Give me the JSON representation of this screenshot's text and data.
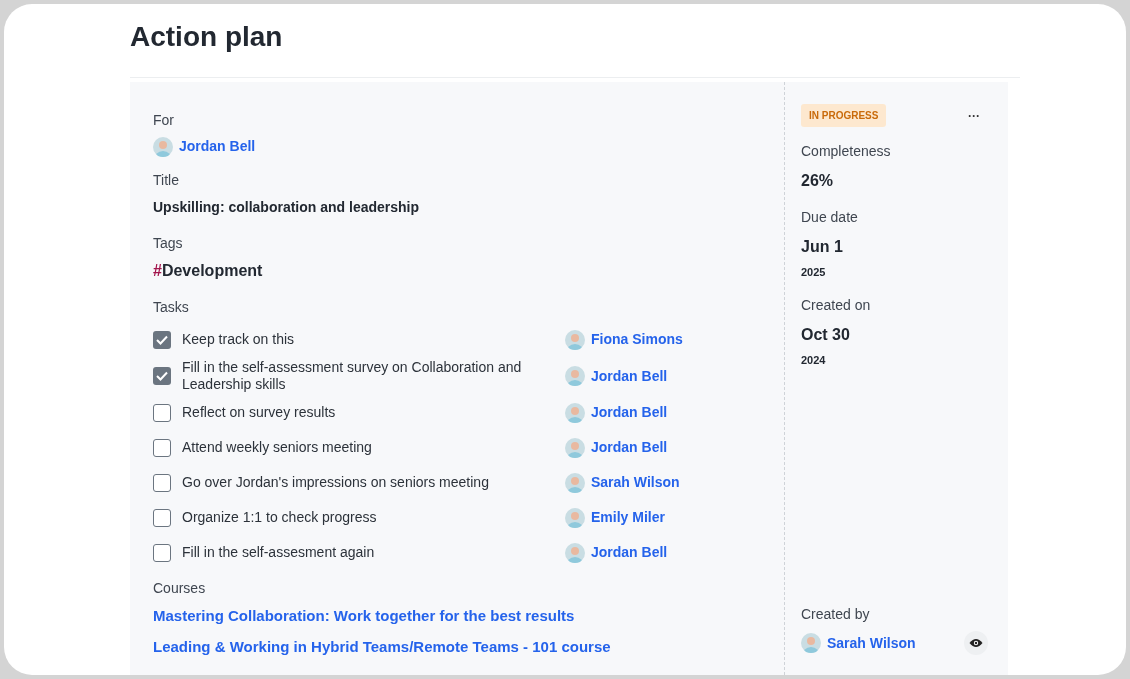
{
  "page": {
    "title": "Action plan"
  },
  "details": {
    "for_label": "For",
    "for_person": "Jordan Bell",
    "title_label": "Title",
    "title": "Upskilling: collaboration and leadership",
    "tags_label": "Tags",
    "tags": [
      {
        "symbol": "#",
        "name": "Development"
      }
    ],
    "tasks_label": "Tasks",
    "tasks": [
      {
        "text": "Keep track on this",
        "checked": true,
        "assignee": "Fiona Simons"
      },
      {
        "text": "Fill in the self-assessment survey on Collaboration and Leadership skills",
        "checked": true,
        "assignee": "Jordan Bell"
      },
      {
        "text": "Reflect on survey results",
        "checked": false,
        "assignee": "Jordan Bell"
      },
      {
        "text": "Attend weekly seniors meeting",
        "checked": false,
        "assignee": "Jordan Bell"
      },
      {
        "text": "Go over Jordan's impressions on seniors meeting",
        "checked": false,
        "assignee": "Sarah Wilson"
      },
      {
        "text": "Organize 1:1 to check progress",
        "checked": false,
        "assignee": "Emily Miler"
      },
      {
        "text": "Fill in the self-assesment again",
        "checked": false,
        "assignee": "Jordan Bell"
      }
    ],
    "courses_label": "Courses",
    "courses": [
      "Mastering Collaboration: Work together for the best results",
      "Leading & Working in Hybrid Teams/Remote Teams - 101 course"
    ]
  },
  "sidebar": {
    "status": "IN PROGRESS",
    "more": "···",
    "fields": [
      {
        "label": "Completeness",
        "value": "26%"
      },
      {
        "label": "Due date",
        "value": "Jun 1",
        "sub": "2025"
      },
      {
        "label": "Created on",
        "value": "Oct 30",
        "sub": "2024"
      }
    ],
    "created_by_label": "Created by",
    "created_by": "Sarah Wilson"
  }
}
